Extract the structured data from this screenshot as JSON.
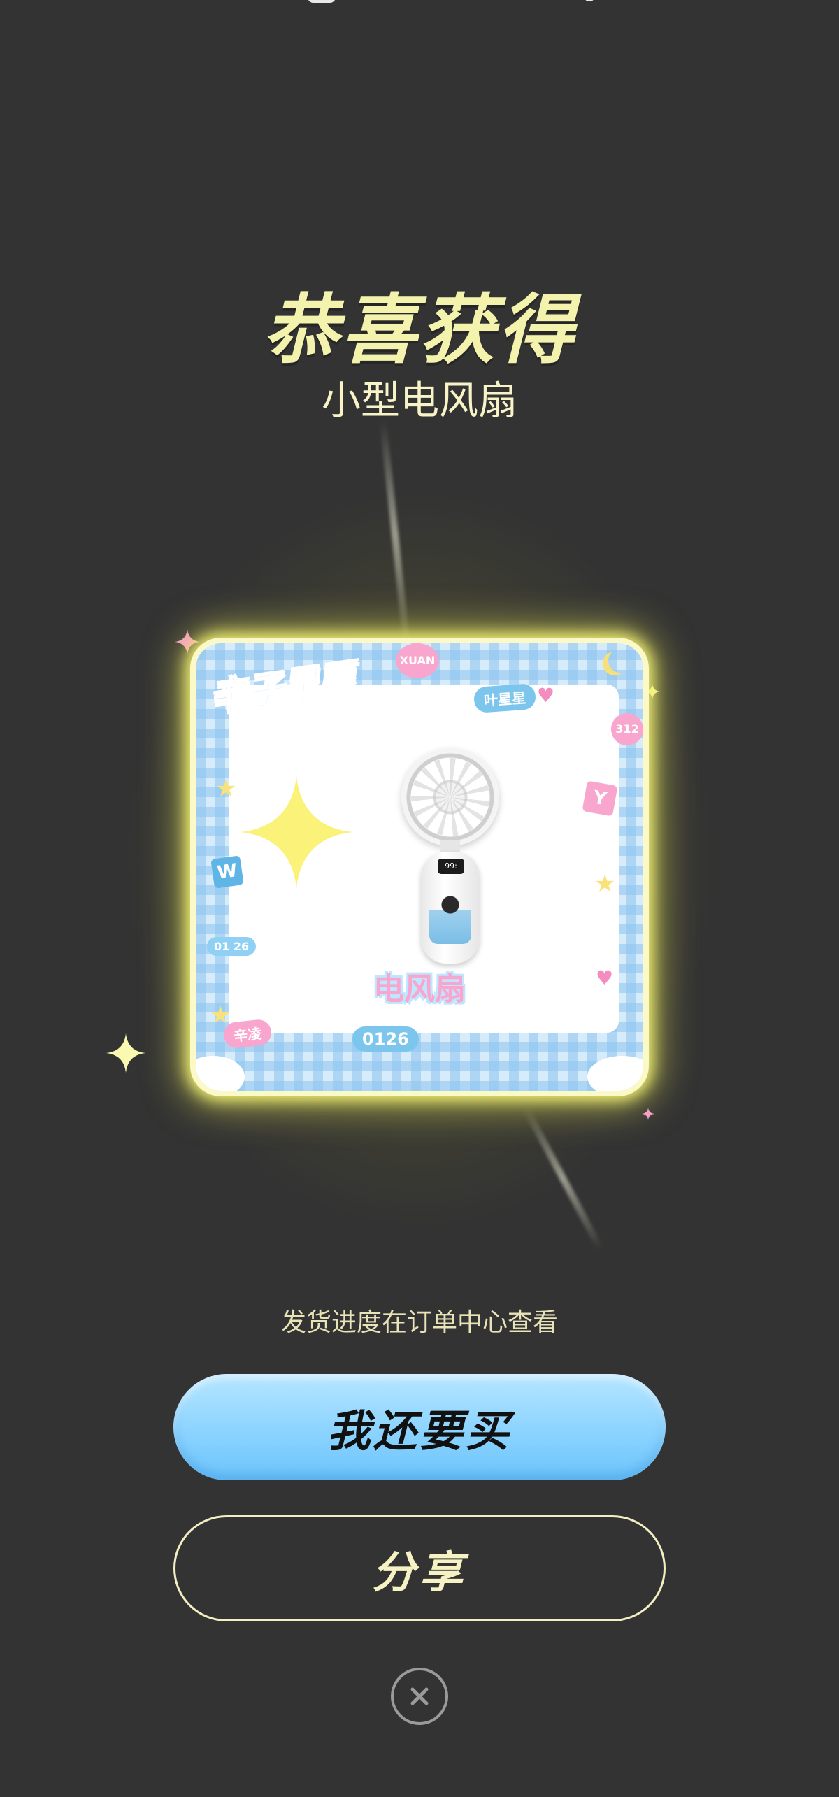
{
  "title": "恭喜获得",
  "prize_name": "小型电风扇",
  "card": {
    "heading": "辛子星愿",
    "product_label": "电风扇",
    "stickers": {
      "xuan": "XUAN",
      "yexing": "叶星星",
      "xinling": "辛凌",
      "code": "0126",
      "date": "01 26",
      "w": "W",
      "y": "Y",
      "num": "312"
    },
    "fan_display": "99:"
  },
  "hint": "发货进度在订单中心查看",
  "buttons": {
    "buy_again": "我还要买",
    "share": "分享"
  },
  "close_icon": "close-circle-icon",
  "colors": {
    "background": "#333333",
    "title": "#f4f3ae",
    "primary_button": "#8bd3ff",
    "secondary_border": "#f3efc2",
    "glow": "#faf878"
  }
}
